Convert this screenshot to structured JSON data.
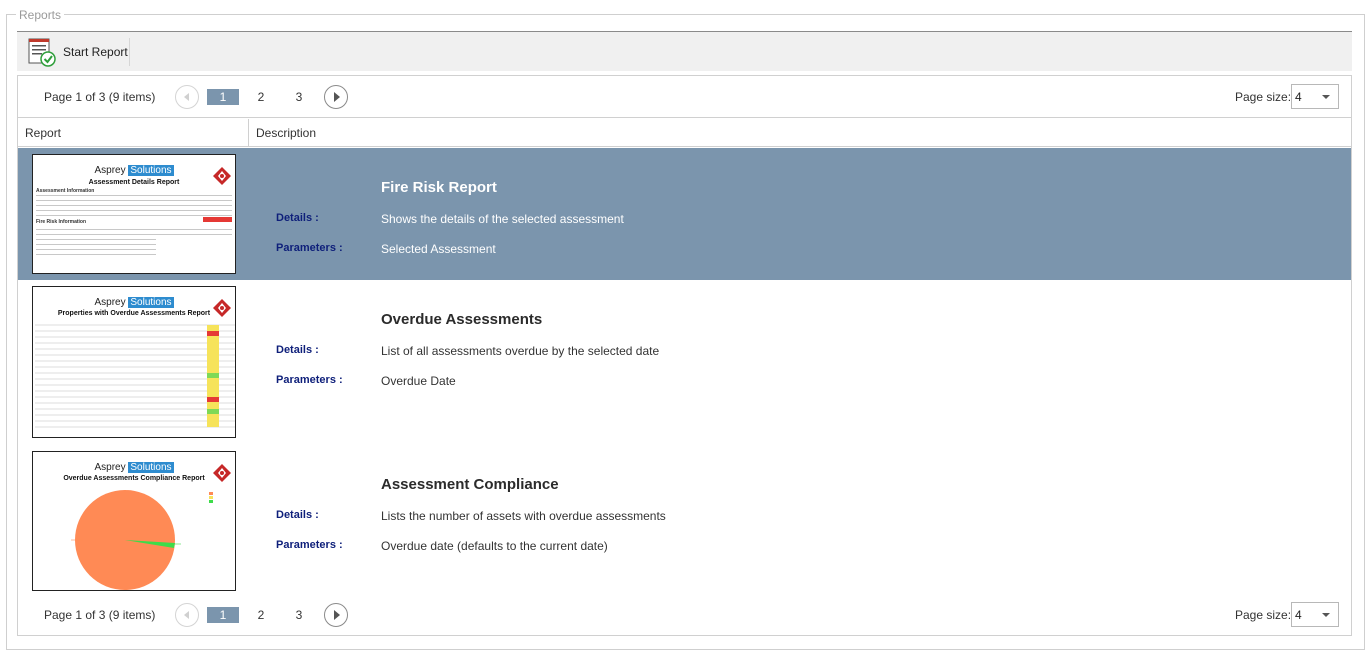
{
  "group_title": "Reports",
  "toolbar": {
    "start_report_label": "Start Report"
  },
  "pager": {
    "summary": "Page 1 of 3 (9 items)",
    "pages": [
      "1",
      "2",
      "3"
    ],
    "page_size_label": "Page size:",
    "page_size_value": "4"
  },
  "columns": {
    "report": "Report",
    "description": "Description"
  },
  "details_label": "Details :",
  "parameters_label": "Parameters :",
  "reports": [
    {
      "title": "Fire Risk Report",
      "details": "Shows the details of the selected assessment",
      "parameters": "Selected Assessment",
      "thumb_logo_1": "Asprey",
      "thumb_logo_2": "Solutions",
      "thumb_title": "Assessment Details Report",
      "thumb_heading": "Assessment Information",
      "thumb_subheading": "Fire Risk Information"
    },
    {
      "title": "Overdue Assessments",
      "details": "List of all assessments overdue by the selected date",
      "parameters": "Overdue Date",
      "thumb_logo_1": "Asprey",
      "thumb_logo_2": "Solutions",
      "thumb_title": "Properties with Overdue Assessments Report"
    },
    {
      "title": "Assessment Compliance",
      "details": "Lists the number of assets with overdue assessments",
      "parameters": "Overdue date (defaults to the current date)",
      "thumb_logo_1": "Asprey",
      "thumb_logo_2": "Solutions",
      "thumb_title": "Overdue Assessments Compliance Report"
    }
  ],
  "colors": {
    "selected_row": "#7b95ad",
    "label_blue": "#0e1f7a",
    "pie_main": "#ff8a55",
    "pie_slice": "#3ddc4a"
  }
}
